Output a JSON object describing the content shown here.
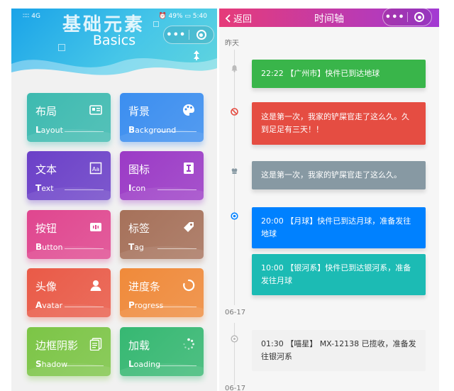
{
  "left": {
    "status_bar": {
      "signal": "∶∶∶∶ 4G",
      "right": "⏰ 49% ▭ 5:40"
    },
    "hero_big": "基础元素",
    "hero_sub": "Basics",
    "capsule": {
      "menu": "•••"
    },
    "cards": [
      {
        "zh": "布局",
        "en_first": "L",
        "en_rest": "ayout",
        "icon": "layout-icon",
        "color": "#3dbab0"
      },
      {
        "zh": "背景",
        "en_first": "B",
        "en_rest": "ackground",
        "icon": "palette-icon",
        "color": "#3b8ef0"
      },
      {
        "zh": "文本",
        "en_first": "T",
        "en_rest": "ext",
        "icon": "text-icon",
        "color": "#6b40c8"
      },
      {
        "zh": "图标",
        "en_first": "I",
        "en_rest": "con",
        "icon": "icon-icon",
        "color": "#9b3ac6"
      },
      {
        "zh": "按钮",
        "en_first": "B",
        "en_rest": "utton",
        "icon": "button-icon",
        "color": "#e0468f"
      },
      {
        "zh": "标签",
        "en_first": "T",
        "en_rest": "ag",
        "icon": "tag-icon",
        "color": "#a6715a"
      },
      {
        "zh": "头像",
        "en_first": "A",
        "en_rest": "vatar",
        "icon": "avatar-icon",
        "color": "#ea5a47"
      },
      {
        "zh": "进度条",
        "en_first": "P",
        "en_rest": "rogress",
        "icon": "progress-icon",
        "color": "#f08a3a"
      },
      {
        "zh": "边框阴影",
        "en_first": "S",
        "en_rest": "hadow",
        "icon": "shadow-icon",
        "color": "#7cc546"
      },
      {
        "zh": "加载",
        "en_first": "L",
        "en_rest": "oading",
        "icon": "loading-icon",
        "color": "#36b872"
      }
    ]
  },
  "right": {
    "back_label": "返回",
    "title": "时间轴",
    "capsule": {
      "menu": "•••"
    },
    "dates": [
      "昨天",
      "06-17",
      "06-17"
    ],
    "events": [
      {
        "text": "22:22 【广州市】快件已到达地球",
        "bg": "#39b54a",
        "fg": "#ffffff",
        "icon": "bell-icon"
      },
      {
        "text": "这是第一次，我家的铲屎官走了这么久。久到足足有三天！！",
        "bg": "#e54d42",
        "fg": "#ffffff",
        "icon": "no-icon"
      },
      {
        "text": "这是第一次，我家的铲屎官走了这么久。",
        "bg": "#8799a3",
        "fg": "#ffffff",
        "icon": "badge-icon"
      },
      {
        "text": "20:00 【月球】快件已到达月球，准备发往地球",
        "bg": "#0081ff",
        "fg": "#ffffff",
        "icon": "target-icon"
      },
      {
        "text": "10:00 【银河系】快件已到达银河系，准备发往月球",
        "bg": "#1cbbb4",
        "fg": "#ffffff",
        "icon": ""
      },
      {
        "text": "01:30 【喵星】 MX-12138 已揽收，准备发往银河系",
        "bg": "#f1f1f1",
        "fg": "#333333",
        "icon": "circle-icon"
      }
    ]
  }
}
